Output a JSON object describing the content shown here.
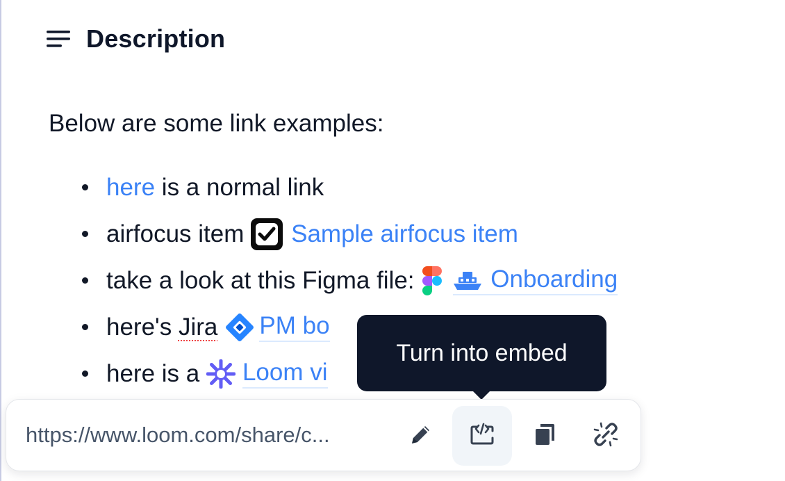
{
  "description": {
    "heading": "Description",
    "icon": "align-left-icon"
  },
  "intro_text": "Below are some link examples:",
  "items": [
    {
      "link": "here",
      "after": " is a normal link"
    },
    {
      "before": "airfocus item ",
      "icon": "checkbox-icon",
      "link": "Sample airfocus item"
    },
    {
      "before": "take a look at this Figma file: ",
      "icon": "figma-icon",
      "icon2": "ship-icon",
      "link": "Onboarding"
    },
    {
      "before": "here's ",
      "spell": "Jira",
      "icon": "jira-icon",
      "link": "PM bo"
    },
    {
      "before": "here is a ",
      "icon": "loom-icon",
      "link": "Loom vi"
    }
  ],
  "tooltip": {
    "text": "Turn into embed"
  },
  "toolbar": {
    "url": "https://www.loom.com/share/c...",
    "buttons": [
      "edit-link",
      "turn-into-embed",
      "copy-link",
      "unlink"
    ]
  },
  "colors": {
    "link": "#3b82f6",
    "text": "#111827",
    "tooltip_bg": "#0f172a"
  }
}
